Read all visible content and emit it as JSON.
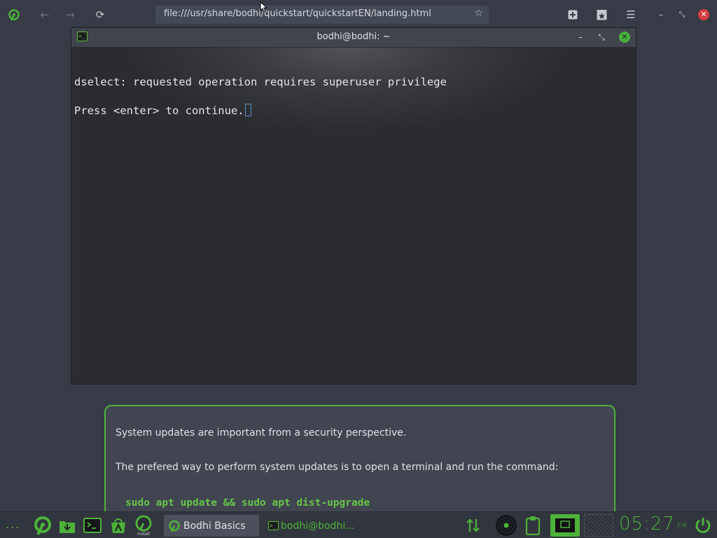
{
  "browser": {
    "url": "file:///usr/share/bodhi/quickstart/quickstartEN/landing.html"
  },
  "terminal": {
    "title": "bodhi@bodhi: ~",
    "lines": [
      "dselect: requested operation requires superuser privilege",
      "Press <enter> to continue."
    ]
  },
  "card": {
    "paragraph_1": "System updates are important from a security perspective.",
    "paragraph_2": "The prefered way to perform system updates is to open a terminal and run the command:",
    "command": "sudo apt update && sudo apt dist-upgrade"
  },
  "taskbar": {
    "dots": "...",
    "tasks": [
      {
        "label": "Bodhi Basics"
      },
      {
        "label": "bodhi@bodhi..."
      }
    ],
    "install_label": "install",
    "clock": {
      "time": "05:27",
      "ampm": "PM"
    }
  },
  "colors": {
    "accent": "#4cb23a",
    "background": "#363b45",
    "terminal_bg": "#2b2c30",
    "close_red": "#d73d3d"
  },
  "icons": [
    "bodhi-logo-icon",
    "back-arrow-icon",
    "forward-arrow-icon",
    "reload-icon",
    "bookmark-star-icon",
    "new-tab-icon",
    "bookmarks-icon",
    "menu-icon",
    "minimize-icon",
    "restore-icon",
    "close-icon",
    "terminal-icon",
    "download-icon",
    "app-store-icon",
    "network-icon",
    "vinyl-icon",
    "clipboard-icon",
    "power-icon"
  ]
}
